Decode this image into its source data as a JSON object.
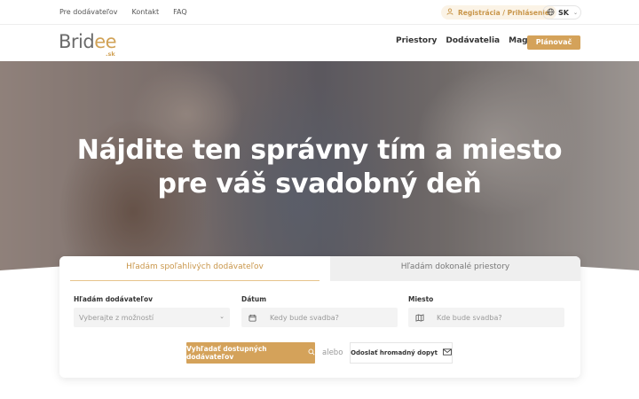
{
  "topbar": {
    "links": [
      "Pre dodávateľov",
      "Kontakt",
      "FAQ"
    ],
    "register_label": "Registrácia / Prihlásenie",
    "language": "SK"
  },
  "nav": {
    "logo_main": "Brid",
    "logo_accent": "ee",
    "logo_domain": ".sk",
    "links": [
      "Priestory",
      "Dodávatelia",
      "Magazín"
    ],
    "planner_label": "Plánovač"
  },
  "hero": {
    "title_line1": "Nájdite ten správny tím a miesto",
    "title_line2": "pre váš svadobný deň"
  },
  "search": {
    "tabs": [
      "Hľadám spoľahlivých dodávateľov",
      "Hľadám dokonalé priestory"
    ],
    "active_tab": 0,
    "vendor_label": "Hľadám dodávateľov",
    "vendor_placeholder": "Vyberajte z možností",
    "date_label": "Dátum",
    "date_placeholder": "Kedy bude svadba?",
    "place_label": "Miesto",
    "place_placeholder": "Kde bude svadba?",
    "search_button": "Vyhľadať dostupných dodávateľov",
    "or_text": "alebo",
    "bulk_button": "Odoslať hromadný dopyt"
  },
  "colors": {
    "accent": "#d4a25a",
    "accent_text": "#c9964a",
    "text": "#333333"
  }
}
